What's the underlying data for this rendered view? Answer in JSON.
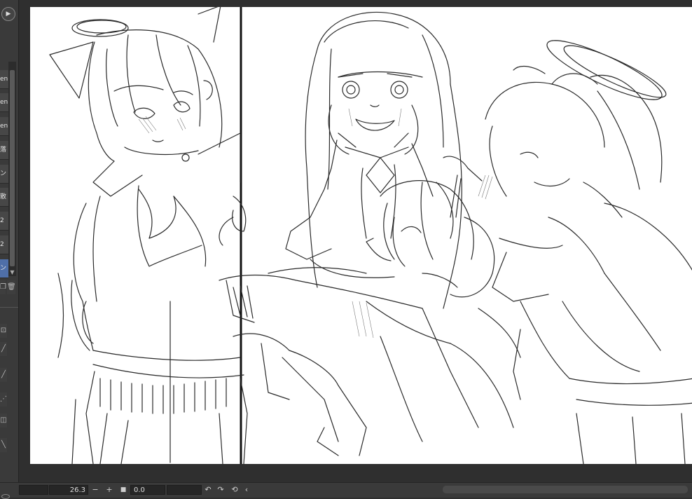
{
  "left_panel": {
    "top_button_icon": "play-circle-icon",
    "items": [
      {
        "label": "en",
        "selected": false
      },
      {
        "label": "en",
        "selected": false
      },
      {
        "label": "en",
        "selected": false
      },
      {
        "label": "落",
        "selected": false
      },
      {
        "label": "ン",
        "selected": false
      },
      {
        "label": "散",
        "selected": false
      },
      {
        "label": "2",
        "selected": false
      },
      {
        "label": "2",
        "selected": false
      },
      {
        "label": "ン",
        "selected": true
      }
    ],
    "tools": [
      "lock-icon",
      "pen-icon",
      "pencil-icon",
      "brush-icon",
      "bucket-icon",
      "line-icon"
    ]
  },
  "status_bar": {
    "zoom_value": "26.3",
    "zoom_minus": "−",
    "zoom_plus": "+",
    "rotation_value": "0.0"
  }
}
